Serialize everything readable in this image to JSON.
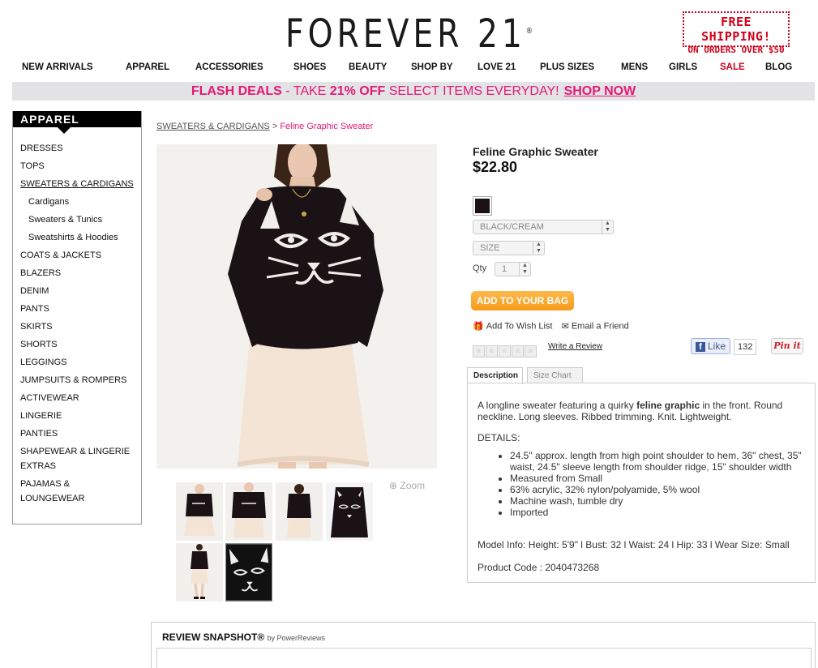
{
  "header": {
    "logo": "FOREVER 21",
    "logo_mark": "®",
    "promo_line1": "FREE SHIPPING!",
    "promo_line2": "ON ORDERS OVER $50"
  },
  "nav": [
    "NEW ARRIVALS",
    "APPAREL",
    "ACCESSORIES",
    "SHOES",
    "BEAUTY",
    "SHOP BY",
    "LOVE 21",
    "PLUS SIZES",
    "MENS",
    "GIRLS",
    "SALE",
    "BLOG"
  ],
  "flash": {
    "prefix": "FLASH DEALS",
    "middle": " - TAKE ",
    "bold": "21% OFF",
    "suffix": " SELECT ITEMS EVERYDAY!",
    "link": "SHOP NOW"
  },
  "sidebar": {
    "title": "APPAREL",
    "items": [
      "DRESSES",
      "TOPS",
      "SWEATERS & CARDIGANS",
      "Cardigans",
      "Sweaters & Tunics",
      "Sweatshirts & Hoodies",
      "COATS & JACKETS",
      "BLAZERS",
      "DENIM",
      "PANTS",
      "SKIRTS",
      "SHORTS",
      "LEGGINGS",
      "JUMPSUITS & ROMPERS",
      "ACTIVEWEAR",
      "LINGERIE",
      "PANTIES",
      "SHAPEWEAR & LINGERIE",
      "EXTRAS",
      "PAJAMAS &",
      "LOUNGEWEAR"
    ]
  },
  "breadcrumb": {
    "parent": "SWEATERS & CARDIGANS",
    "separator": ">",
    "current": "Feline Graphic Sweater"
  },
  "gallery": {
    "zoom_label": "Zoom"
  },
  "product": {
    "name": "Feline Graphic Sweater",
    "price": "$22.80",
    "swatch_color": "#1b1214",
    "color_value": "BLACK/CREAM",
    "size_value": "SIZE",
    "qty_label": "Qty",
    "qty_value": "1",
    "add_to_bag": "ADD TO YOUR BAG",
    "wishlist": "Add To Wish List",
    "email": "Email a Friend",
    "write_review": "Write a Review",
    "like_label": "Like",
    "like_count": "132",
    "pin_label": "Pin it"
  },
  "tabs": {
    "description": "Description",
    "size_chart": "Size Chart"
  },
  "description": {
    "intro_pre": "A longline sweater featuring a quirky ",
    "intro_bold": "feline graphic",
    "intro_post": " in the front. Round neckline. Long sleeves. Ribbed trimming. Knit. Lightweight.",
    "details_label": "DETAILS:",
    "details": [
      "24.5\" approx. length from high point shoulder to hem, 36\" chest, 35\" waist, 24.5\" sleeve length from shoulder ridge, 15\" shoulder width",
      "Measured from Small",
      "63% acrylic, 32% nylon/polyamide, 5% wool",
      "Machine wash, tumble dry",
      "Imported"
    ],
    "model_info": "Model Info: Height: 5'9\" l Bust: 32 l Waist: 24 l Hip: 33 l Wear Size: Small",
    "product_code": "Product Code : 2040473268"
  },
  "review": {
    "title": "REVIEW SNAPSHOT®",
    "by": "by PowerReviews"
  }
}
